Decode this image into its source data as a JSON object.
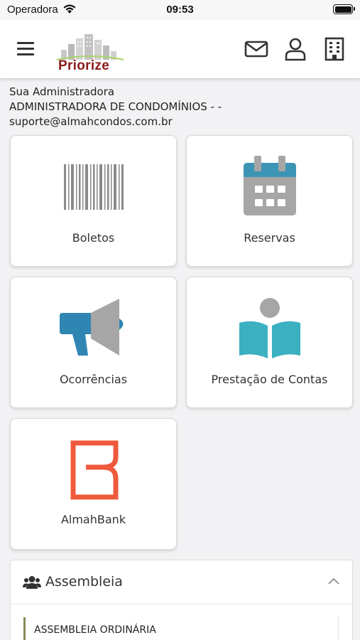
{
  "status_bar": {
    "carrier": "Operadora",
    "time": "09:53"
  },
  "header": {
    "logo_text": "Priorize",
    "icons": [
      "menu-icon",
      "mail-icon",
      "user-icon",
      "building-icon"
    ],
    "brand_color": "#8b1a1a"
  },
  "administradora": {
    "title": "Sua Administradora",
    "name": "ADMINISTRADORA DE CONDOMÍNIOS - -",
    "email": "suporte@almahcondos.com.br"
  },
  "cards": [
    {
      "label": "Boletos",
      "icon": "barcode-icon"
    },
    {
      "label": "Reservas",
      "icon": "calendar-icon"
    },
    {
      "label": "Ocorrências",
      "icon": "megaphone-icon"
    },
    {
      "label": "Prestação de Contas",
      "icon": "book-reader-icon"
    },
    {
      "label": "AlmahBank",
      "icon": "almahbank-logo-icon"
    }
  ],
  "assembleia": {
    "title": "Assembleia",
    "item": "ASSEMBLEIA ORDINÁRIA"
  },
  "colors": {
    "calendar_top": "#3d95b5",
    "icon_gray": "#a6a6a6",
    "megaphone_blue": "#2f86b3",
    "book_teal": "#3ab0c0",
    "almahbank_red": "#f05a3c"
  }
}
